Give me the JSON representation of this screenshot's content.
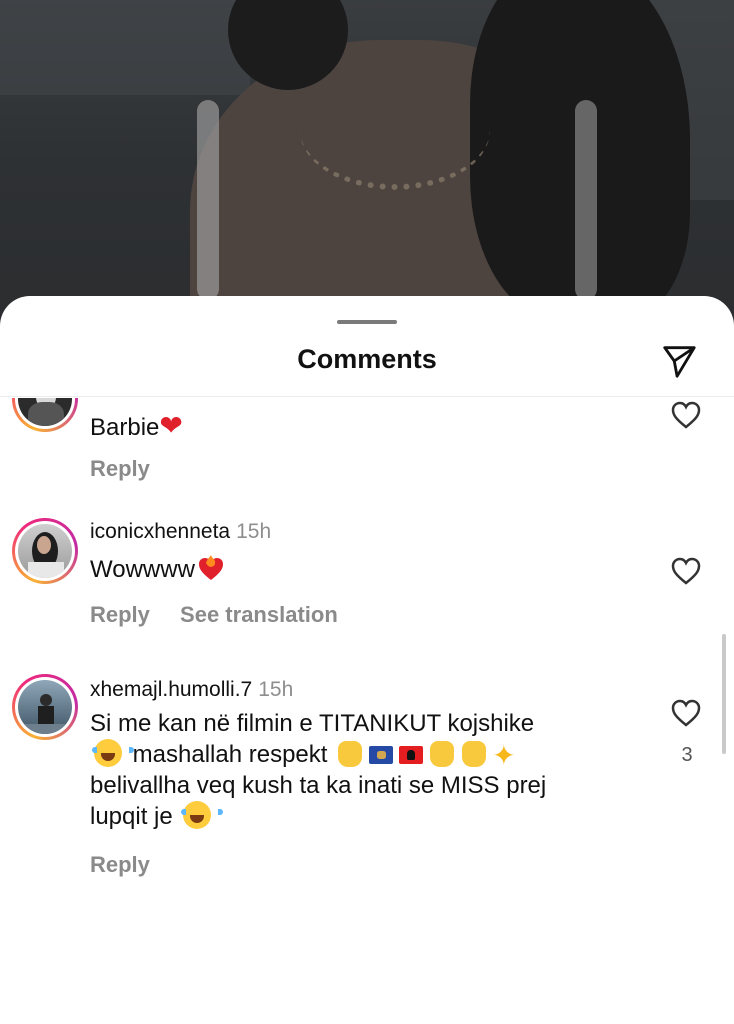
{
  "sheet": {
    "title": "Comments",
    "share_icon": "paper-plane-icon"
  },
  "comments": [
    {
      "username": "",
      "time": "",
      "text": "Barbie",
      "emoji": [
        "red-heart"
      ],
      "actions": [
        "Reply"
      ]
    },
    {
      "username": "iconicxhenneta",
      "time": "15h",
      "text": "Wowwww",
      "emoji": [
        "heart-on-fire"
      ],
      "actions": [
        "Reply",
        "See translation"
      ]
    },
    {
      "username": "xhemajl.humolli.7",
      "time": "15h",
      "text_lines": [
        "Si me kan në filmin e TITANIKUT kojshike",
        "mashallah respekt",
        "belivallha veq kush ta ka inati  se MISS prej",
        "lupqit  je"
      ],
      "emoji": [
        "laughing-tears",
        "clapping-hands",
        "kosovo-flag",
        "albania-flag",
        "victory-hand",
        "ok-hand",
        "glowing-star"
      ],
      "like_count": "3",
      "actions": [
        "Reply"
      ]
    }
  ],
  "colors": {
    "accent_ring": "#ee2a7b",
    "secondary_text": "#8e8e8e"
  }
}
